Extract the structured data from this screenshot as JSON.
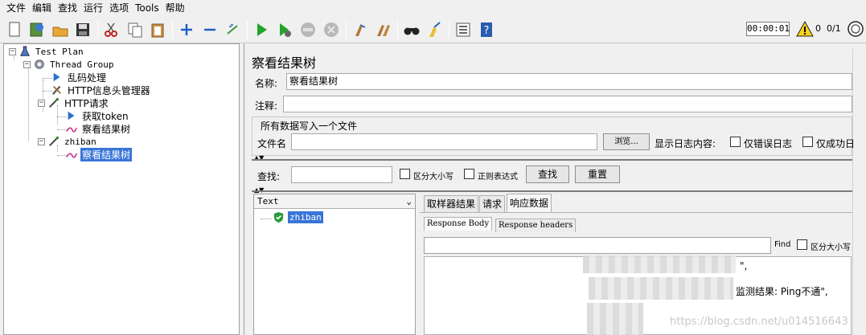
{
  "menu": [
    "文件",
    "编辑",
    "查找",
    "运行",
    "选项",
    "Tools",
    "帮助"
  ],
  "toolbar": {
    "timer": "00:00:01",
    "warning_count": "0",
    "thread_count": "0/1",
    "icons": [
      "new-icon",
      "templates-icon",
      "open-icon",
      "save-icon",
      "cut-icon",
      "copy-icon",
      "paste-icon",
      "expand-icon",
      "collapse-icon",
      "toggle-icon",
      "start-icon",
      "start-no-pause-icon",
      "stop-icon",
      "shutdown-icon",
      "clear-icon",
      "clear-all-icon",
      "search-icon",
      "reset-search-icon",
      "function-helper-icon",
      "help-icon"
    ]
  },
  "tree": {
    "items": [
      {
        "label": "Test Plan"
      },
      {
        "label": "Thread Group"
      },
      {
        "label": "乱码处理"
      },
      {
        "label": "HTTP信息头管理器"
      },
      {
        "label": "HTTP请求"
      },
      {
        "label": "获取token"
      },
      {
        "label": "察看结果树"
      },
      {
        "label": "zhiban"
      },
      {
        "label": "察看结果树"
      }
    ]
  },
  "panel": {
    "title": "察看结果树",
    "name_label": "名称:",
    "name_value": "察看结果树",
    "comment_label": "注释:",
    "comment_value": "",
    "file_section_title": "所有数据写入一个文件",
    "filename_label": "文件名",
    "browse_button": "浏览...",
    "log_label": "显示日志内容:",
    "errors_only": "仅错误日志",
    "success_only": "仅成功日"
  },
  "search": {
    "label": "查找:",
    "case_sensitive": "区分大小写",
    "regex": "正则表达式",
    "find_button": "查找",
    "reset_button": "重置"
  },
  "results": {
    "renderer": "Text",
    "samples": [
      {
        "label": "zhiban",
        "status": "success"
      }
    ],
    "tabs": [
      "取样器结果",
      "请求",
      "响应数据"
    ],
    "active_tab": "响应数据",
    "subtabs": [
      "Response Body",
      "Response headers"
    ],
    "body_find_label": "Find",
    "body_case_label": "区分大小写",
    "body_lines": [
      "\",",
      "监测结果: Ping不通\","
    ]
  },
  "watermark": "https://blog.csdn.net/u014516643"
}
